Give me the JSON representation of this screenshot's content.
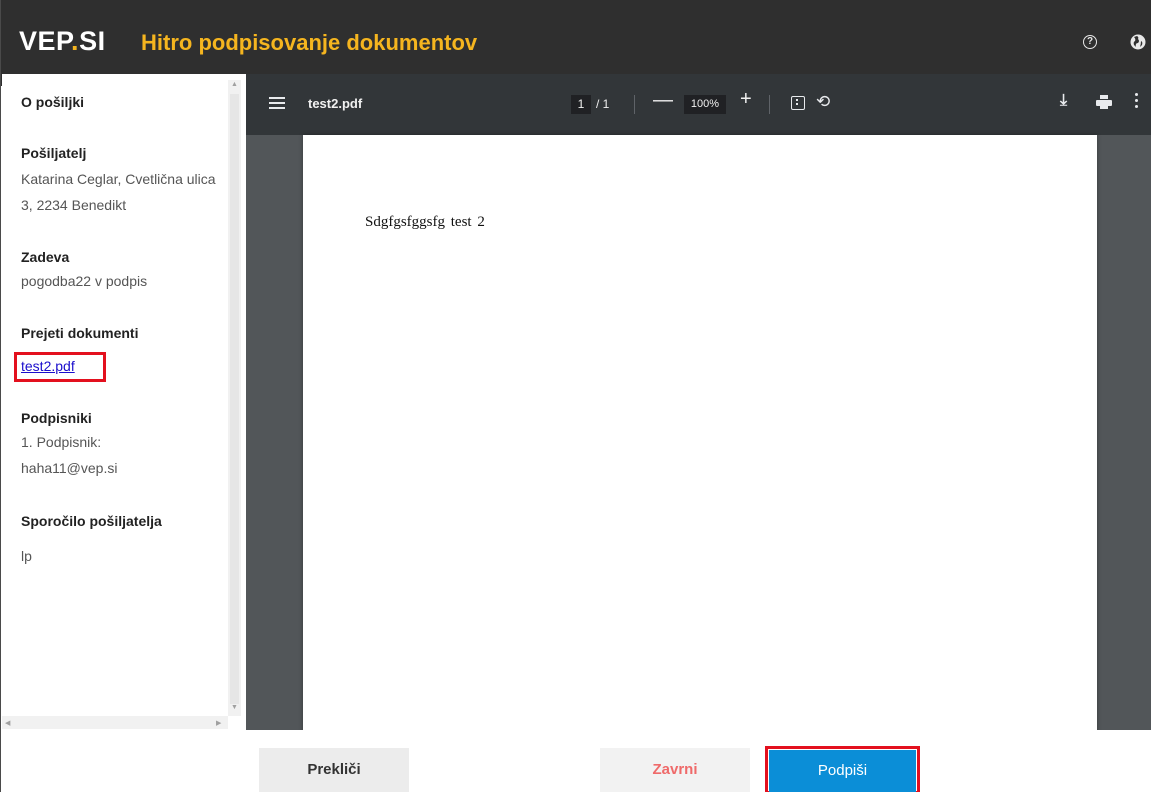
{
  "header": {
    "logo_main": "VEP",
    "logo_dot": ".",
    "logo_tail": "SI",
    "title": "Hitro podpisovanje dokumentov",
    "help_icon": "help-circle-icon",
    "language_icon": "globe-icon"
  },
  "sidebar": {
    "heading": "O pošiljki",
    "sender_label": "Pošiljatelj",
    "sender_value": "Katarina Ceglar, Cvetlična ulica 3, 2234 Benedikt",
    "subject_label": "Zadeva",
    "subject_value": "pogodba22 v podpis",
    "documents_label": "Prejeti dokumenti",
    "documents": [
      "test2.pdf"
    ],
    "signers_label": "Podpisniki",
    "signers_line1": "1. Podpisnik:",
    "signers_line2": "haha11@vep.si",
    "message_label": "Sporočilo pošiljatelja",
    "message_value": "lp"
  },
  "viewer": {
    "file_name": "test2.pdf",
    "current_page": "1",
    "total_pages": "/ 1",
    "zoom_out_label": "—",
    "zoom": "100%",
    "zoom_in_label": "+",
    "icons": [
      "menu-icon",
      "fit-page-icon",
      "rotate-icon",
      "download-icon",
      "print-icon",
      "more-icon"
    ],
    "page_text": "Sdgfgsfggsfg  test 2",
    "background_color": "#525659",
    "toolbar_color": "#323639"
  },
  "footer": {
    "cancel_label": "Prekliči",
    "finish_label": "Zavrni",
    "sign_label": "Podpiši"
  },
  "colors": {
    "header_bg": "#2f2f2f",
    "accent": "#f5b51f",
    "primary": "#0b8ed7",
    "highlight": "#e3101e",
    "danger_text": "#ef6a6a"
  }
}
